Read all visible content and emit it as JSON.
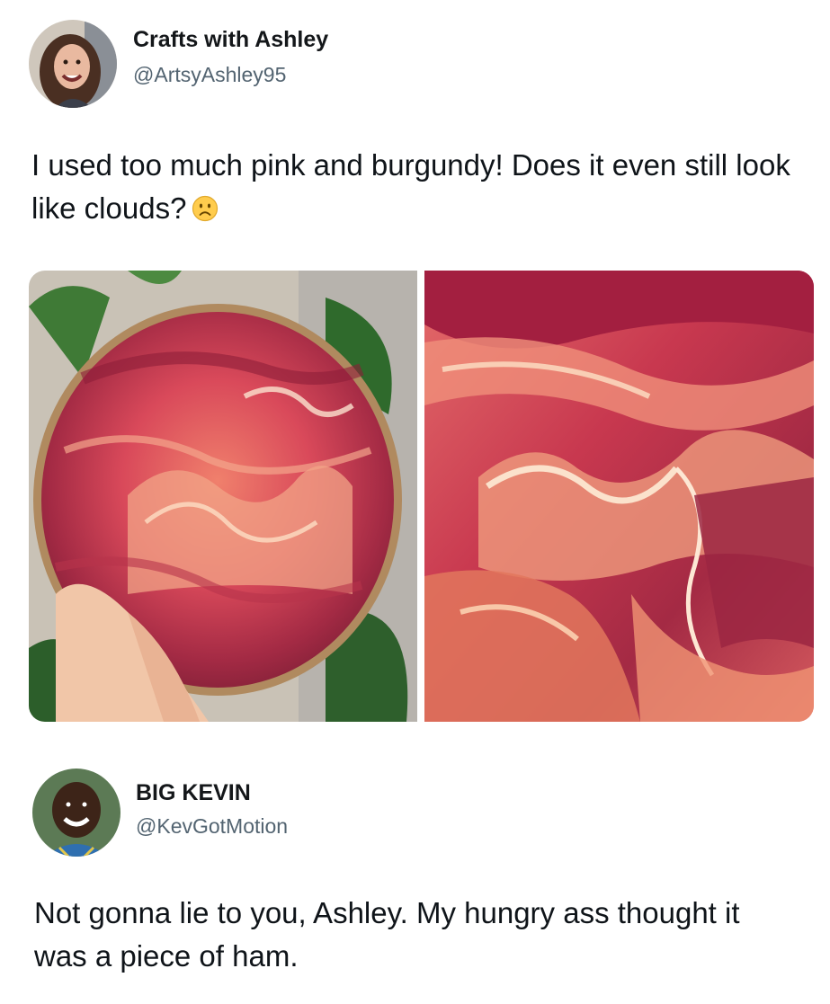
{
  "tweet_1": {
    "display_name": "Crafts with Ashley",
    "handle": "@ArtsyAshley95",
    "text": "I used too much pink and burgundy! Does it even still look like clouds?",
    "emoji": "slightly-frowning-face",
    "media": [
      {
        "icon": "painted-wood-slice-photo"
      },
      {
        "icon": "painting-closeup-photo"
      }
    ]
  },
  "tweet_2": {
    "display_name": "BIG KEVIN",
    "handle": "@KevGotMotion",
    "text": "Not gonna lie to you, Ashley. My hungry ass thought it was a piece of ham."
  },
  "colors": {
    "text": "#0f1419",
    "handle": "#536471",
    "burgundy": "#9e2340",
    "pink": "#e8656b",
    "cream": "#f6d7bf"
  }
}
